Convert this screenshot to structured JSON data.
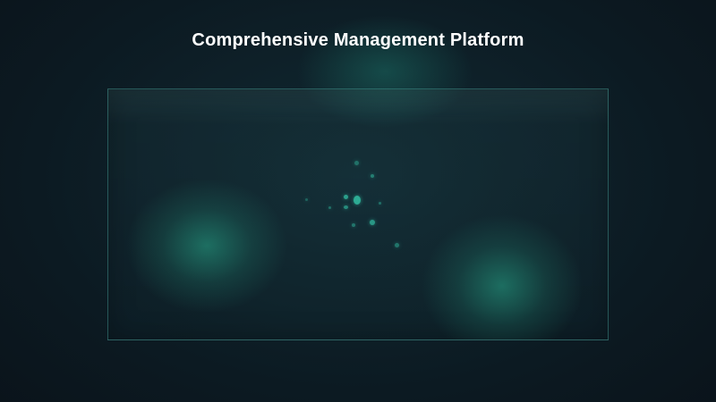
{
  "header": {
    "title": "Comprehensive Management Platform"
  },
  "theme": {
    "background": "#0d1a22",
    "accent": "#2fb39a",
    "panel_border": "#46a096",
    "title_color": "#ffffff"
  }
}
